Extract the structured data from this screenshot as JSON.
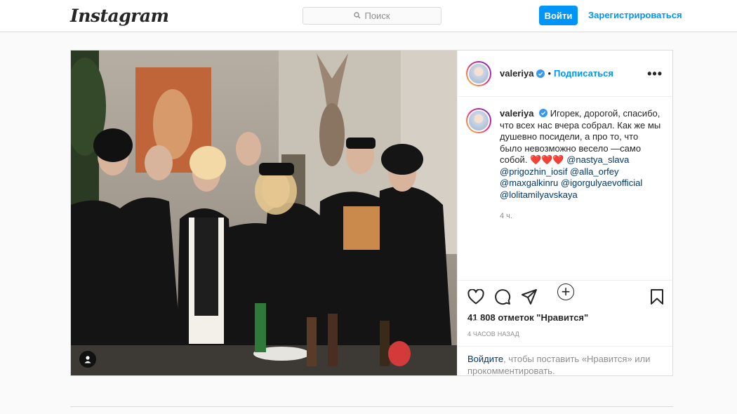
{
  "header": {
    "logo": "Instagram",
    "search_placeholder": "Поиск",
    "login_label": "Войти",
    "signup_label": "Зарегистрироваться"
  },
  "post": {
    "username": "valeriya",
    "follow_label": "Подписаться",
    "caption_text": "Игорек, дорогой, спасибо, что всех нас вчера собрал. Как же мы душевно посидели, а про то, что было невозможно весело —само собой. ❤️❤️❤️",
    "mentions": [
      "@nastya_slava",
      "@prigozhin_iosif",
      "@alla_orfey",
      "@maxgalkinru",
      "@igorgulyaevofficial",
      "@lolitamilyavskaya"
    ],
    "caption_time": "4 ч.",
    "likes": "41 808 отметок \"Нравится\"",
    "time_ago": "4 ЧАСОВ НАЗАД",
    "login_prompt_link": "Войдите",
    "login_prompt_text": ", чтобы поставить «Нравится» или прокомментировать."
  },
  "colors": {
    "accent": "#0095f6",
    "border": "#dbdbdb",
    "background": "#fafafa",
    "muted_text": "#8e8e8e",
    "link_dark": "#00376b"
  },
  "icons": [
    "search-icon",
    "verified-badge-icon",
    "more-options-icon",
    "load-more-comments-icon",
    "heart-icon",
    "comment-icon",
    "share-icon",
    "bookmark-icon",
    "user-tag-icon"
  ]
}
